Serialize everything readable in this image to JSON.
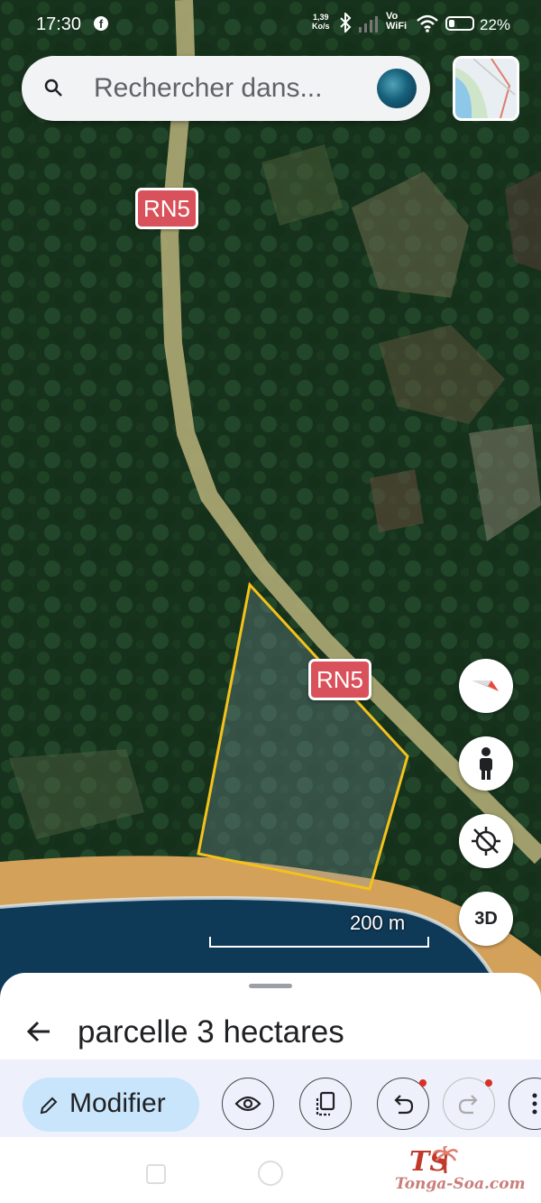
{
  "status_bar": {
    "time": "17:30",
    "network_speed_value": "1,39",
    "network_speed_unit": "Ko/s",
    "vowifi_line1": "Vo",
    "vowifi_line2": "WiFi",
    "battery": "22%",
    "icons": [
      "facebook-icon",
      "bluetooth-icon",
      "signal-icon",
      "wifi-icon",
      "battery-icon"
    ]
  },
  "search": {
    "placeholder": "Rechercher dans..."
  },
  "map": {
    "road_labels": [
      "RN5",
      "RN5"
    ],
    "scale_label": "200 m",
    "controls": [
      "compass",
      "street-view",
      "my-location",
      "3D"
    ],
    "three_d_label": "3D",
    "parcel_outline_color": "#f4c21b",
    "road_shield_color": "#d9515a"
  },
  "sheet": {
    "title": "parcelle 3 hectares",
    "edit_label": "Modifier",
    "toolbar_icons": [
      "eye-icon",
      "copy-icon",
      "undo-icon",
      "redo-icon",
      "more-vert-icon"
    ]
  },
  "watermark": {
    "logo_text": "TS",
    "site": "Tonga-Soa.com"
  }
}
